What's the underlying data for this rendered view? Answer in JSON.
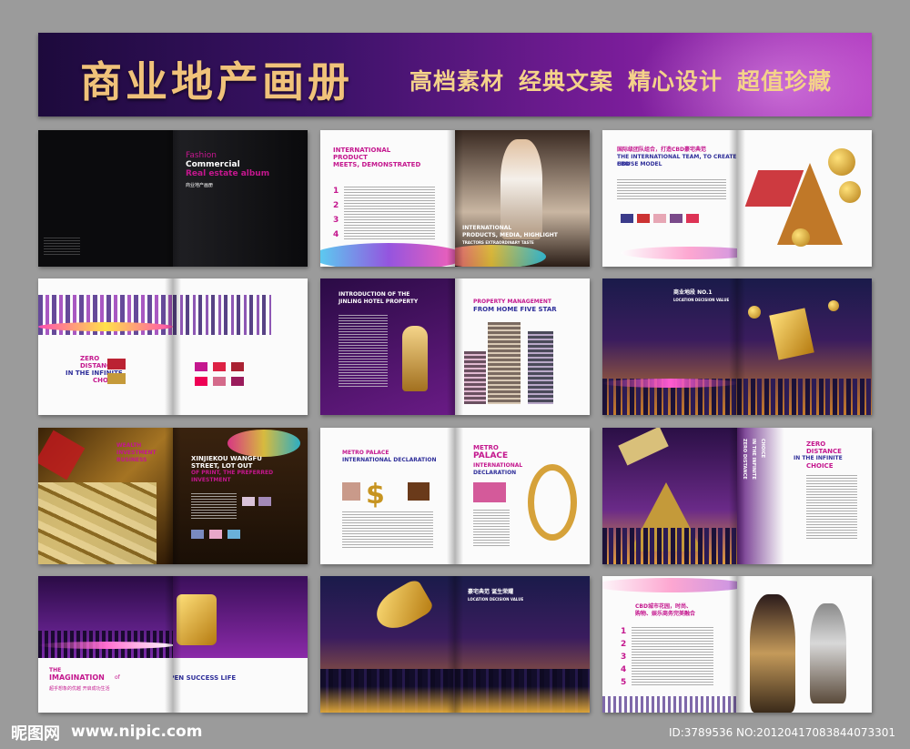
{
  "banner": {
    "title": "商业地产画册",
    "taglines": [
      "高档素材",
      "经典文案",
      "精心设计",
      "超值珍藏"
    ]
  },
  "spreads": {
    "s1": {
      "fashion": "Fashion",
      "commercial": "Commercial",
      "album": "Real estate album",
      "sub": "商业地产画册"
    },
    "s2": {
      "h1": "INTERNATIONAL",
      "h2": "PRODUCT",
      "h3": "MEETS, DEMONSTRATED",
      "n1": "1",
      "n2": "2",
      "n3": "3",
      "n4": "4",
      "b1": "INTERNATIONAL",
      "b2": "PRODUCTS, MEDIA, HIGHLIGHT",
      "b3": "TRACTORS EXTRAORDINARY TASTE"
    },
    "s3": {
      "cn": "国际级团队组合，打造CBD豪宅典范",
      "h1": "THE INTERNATIONAL TEAM, TO CREATE CBD",
      "h2": "HOUSE MODEL"
    },
    "s4": {
      "h1": "ZERO",
      "h2": "DISTANCE",
      "h3": "IN THE INFINITE",
      "h4": "CHOICE"
    },
    "s5": {
      "h1": "INTRODUCTION OF THE",
      "h2": "JINLING HOTEL PROPERTY",
      "h3": "PROPERTY MANAGEMENT",
      "h4": "FROM HOME FIVE STAR"
    },
    "s6": {
      "cn": "商业地段 NO.1",
      "en": "LOCATION DECISION VALUE"
    },
    "s7": {
      "h1": "WEALTH",
      "h2": "INVESTMENT",
      "h3": "BUSINESS",
      "h4": "XINJIEKOU WANGFU",
      "h5": "STREET, LOT OUT",
      "h6": "OF PRINT, THE PREFERRED",
      "h7": "INVESTMENT"
    },
    "s8": {
      "h1": "METRO PALACE",
      "h2": "INTERNATIONAL DECLARATION",
      "h3": "METRO",
      "h4": "PALACE",
      "h5": "INTERNATIONAL",
      "h6": "DECLARATION"
    },
    "s9": {
      "v1": "ZERO DISTANCE",
      "v2": "IN THE INFINITE",
      "v3": "CHOICE",
      "h1": "ZERO",
      "h2": "DISTANCE",
      "h3": "IN THE INFINITE",
      "h4": "CHOICE"
    },
    "s10": {
      "l1": "THE",
      "l2": "IMAGINATION",
      "l3": "of",
      "l4": "SUPERIOR OPEN SUCCESS LIFE",
      "cn": "超乎想象的优越 开启成功生活"
    },
    "s11": {
      "cn": "豪宅典范 诞生荣耀",
      "en": "LOCATION DECISION VALUE"
    },
    "s12": {
      "h1": "CBD城市花园，时尚、",
      "h2": "购物、娱乐商务完美融合",
      "n1": "1",
      "n2": "2",
      "n3": "3",
      "n4": "4",
      "n5": "5"
    }
  },
  "footer": {
    "logo": "昵图网",
    "url": "www.nipic.com",
    "id": "ID:3789536 NO:20120417083844073301"
  },
  "colors": {
    "banner_text": "#f0c27a",
    "accent_pink": "#c4178e",
    "accent_blue": "#2f2f9a",
    "gold": "#f3c43f"
  }
}
